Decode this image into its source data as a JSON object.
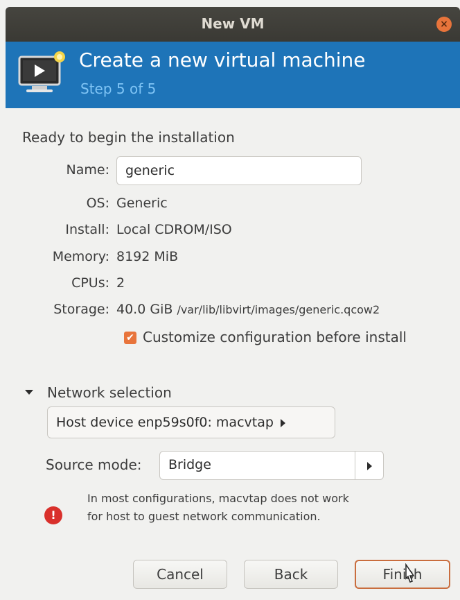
{
  "window": {
    "title": "New VM",
    "close_symbol": "×"
  },
  "banner": {
    "title": "Create a new virtual machine",
    "step": "Step 5 of 5"
  },
  "summary": {
    "heading": "Ready to begin the installation",
    "name_label": "Name:",
    "name_value": "generic",
    "os_label": "OS:",
    "os_value": "Generic",
    "install_label": "Install:",
    "install_value": "Local CDROM/ISO",
    "memory_label": "Memory:",
    "memory_value": "8192 MiB",
    "cpus_label": "CPUs:",
    "cpus_value": "2",
    "storage_label": "Storage:",
    "storage_size": "40.0 GiB",
    "storage_path": "/var/lib/libvirt/images/generic.qcow2",
    "customize_checked": true,
    "customize_label": "Customize configuration before install"
  },
  "network": {
    "section_label": "Network selection",
    "host_device": "Host device enp59s0f0: macvtap",
    "source_mode_label": "Source mode:",
    "source_mode_value": "Bridge",
    "warning": "In most configurations, macvtap does not work for host to guest network communication."
  },
  "buttons": {
    "cancel": "Cancel",
    "back": "Back",
    "finish": "Finish"
  },
  "icons": {
    "banner": "monitor-play-icon",
    "warning": "error-icon",
    "checkbox": "checkmark-icon"
  },
  "colors": {
    "banner_bg": "#1e74b8",
    "accent": "#e8743b",
    "step_text": "#7fc4f5",
    "error": "#d9302b"
  }
}
